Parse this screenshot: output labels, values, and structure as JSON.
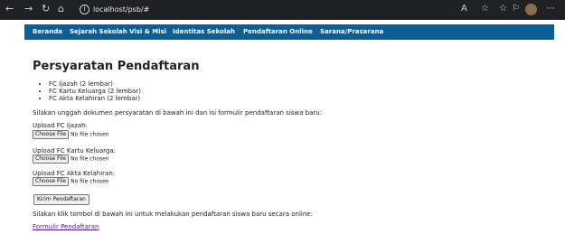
{
  "browser": {
    "back_icon": "←",
    "forward_icon": "→",
    "reload_icon": "↻",
    "home_icon": "⌂",
    "url": "localhost/psb/#",
    "more_icon": "⋯"
  },
  "menu": {
    "items": [
      "Beranda",
      "Sejarah Sekolah",
      "Visi & Misi",
      "Identitas Sekolah",
      "Pendaftaran Online",
      "Sarana/Prasarana"
    ]
  },
  "page": {
    "title": "Persyaratan Pendaftaran",
    "requirements": [
      "FC Ijazah (2 lembar)",
      "FC Kartu Keluarga (2 lembar)",
      "FC Akta Kelahiran (2 lembar)"
    ],
    "instructions": "Silakan unggah dokumen persyaratan di bawah ini dan isi formulir pendaftaran siswa baru:",
    "uploads": [
      {
        "label": "Upload FC Ijazah:",
        "button": "Choose File",
        "status": "No file chosen"
      },
      {
        "label": "Upload FC Kartu Keluarga:",
        "button": "Choose File",
        "status": "No file chosen"
      },
      {
        "label": "Upload FC Akta Kelahiran:",
        "button": "Choose File",
        "status": "No file chosen"
      }
    ],
    "submit_label": "Kirim Pendaftaran",
    "link_instructions": "Silakan klik tombol di bawah ini untuk melakukan pendaftaran siswa baru secara online:",
    "form_link": "Formulir Pendaftaran"
  }
}
